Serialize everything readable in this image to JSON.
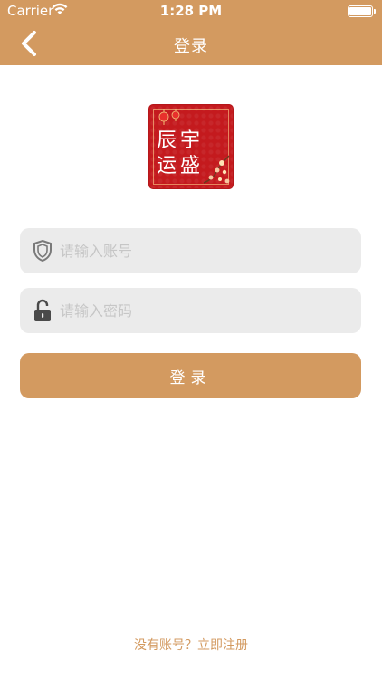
{
  "status_bar": {
    "carrier": "Carrier",
    "time": "1:28 PM",
    "wifi_icon": "wifi-icon",
    "battery_icon": "battery-icon"
  },
  "nav": {
    "title": "登录",
    "back_icon": "chevron-left-icon"
  },
  "logo": {
    "line1": "辰宇",
    "line2": "运盛"
  },
  "form": {
    "account_placeholder": "请输入账号",
    "account_value": "",
    "account_icon": "shield-icon",
    "password_placeholder": "请输入密码",
    "password_value": "",
    "password_icon": "unlock-icon",
    "login_label": "登录"
  },
  "footer": {
    "register_text": "没有账号？立即注册"
  },
  "colors": {
    "accent": "#d39a60",
    "field_bg": "#ebebeb",
    "placeholder": "#c6c6c6",
    "logo_red": "#c41a1e"
  }
}
